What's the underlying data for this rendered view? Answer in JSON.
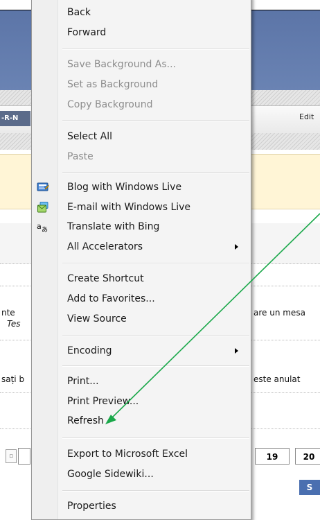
{
  "background": {
    "nav_left": "-R-N",
    "edit_label": "Edit",
    "snippet_1": "nte",
    "snippet_2": "Tes",
    "snippet_3": "are un mesa",
    "snippet_4": "sați b",
    "snippet_5": "este anulat",
    "page_num_1": "19",
    "page_num_2": "20",
    "button_label": "S"
  },
  "menu": {
    "items": [
      {
        "label": "Back",
        "disabled": false
      },
      {
        "label": "Forward",
        "disabled": false
      },
      {
        "label": "Save Background As...",
        "disabled": true
      },
      {
        "label": "Set as Background",
        "disabled": true
      },
      {
        "label": "Copy Background",
        "disabled": true
      },
      {
        "label": "Select All",
        "disabled": false
      },
      {
        "label": "Paste",
        "disabled": true
      },
      {
        "label": "Blog with Windows Live",
        "disabled": false,
        "icon": "blog-icon"
      },
      {
        "label": "E-mail with Windows Live",
        "disabled": false,
        "icon": "email-icon"
      },
      {
        "label": "Translate with Bing",
        "disabled": false,
        "icon": "translate-icon"
      },
      {
        "label": "All Accelerators",
        "disabled": false,
        "submenu": true
      },
      {
        "label": "Create Shortcut",
        "disabled": false
      },
      {
        "label": "Add to Favorites...",
        "disabled": false
      },
      {
        "label": "View Source",
        "disabled": false
      },
      {
        "label": "Encoding",
        "disabled": false,
        "submenu": true
      },
      {
        "label": "Print...",
        "disabled": false
      },
      {
        "label": "Print Preview...",
        "disabled": false
      },
      {
        "label": "Refresh",
        "disabled": false
      },
      {
        "label": "Export to Microsoft Excel",
        "disabled": false
      },
      {
        "label": "Google Sidewiki...",
        "disabled": false
      },
      {
        "label": "Properties",
        "disabled": false
      }
    ]
  },
  "colors": {
    "arrow": "#1aa84a",
    "disabled_text": "#8d8d8d",
    "header_blue": "#5a73a6"
  }
}
